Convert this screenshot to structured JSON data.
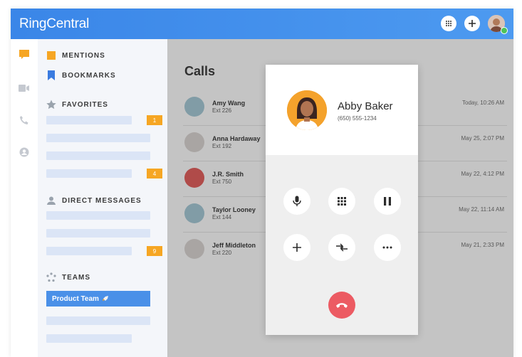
{
  "app": {
    "logo_text": "RingCentral",
    "accent": "#4a90e8"
  },
  "topbar": {
    "dialpad_icon": "dialpad-icon",
    "add_icon": "plus-icon",
    "avatar": "user-avatar",
    "presence_color": "#4cc35a"
  },
  "rail": {
    "icons": [
      "chat-bubble-icon",
      "video-icon",
      "phone-icon",
      "contacts-icon"
    ]
  },
  "sidebar": {
    "mentions": "MENTIONS",
    "bookmarks": "BOOKMARKS",
    "favorites": "FAVORITES",
    "favorites_badges": [
      "1",
      "4"
    ],
    "direct_messages": "DIRECT MESSAGES",
    "dm_badge": "9",
    "teams": "TEAMS",
    "selected_team": "Product Team",
    "badge_color": "#f6a623"
  },
  "main": {
    "title": "Calls",
    "calls": [
      {
        "name": "Amy Wang",
        "ext": "Ext 226",
        "time": "Today, 10:26 AM",
        "color": "#9fc6d4"
      },
      {
        "name": "Anna Hardaway",
        "ext": "Ext 192",
        "time": "May 25, 2:07 PM",
        "color": "#d9d3d0"
      },
      {
        "name": "J.R. Smith",
        "ext": "Ext 750",
        "time": "May 22, 4:12 PM",
        "color": "#e3524f"
      },
      {
        "name": "Taylor Looney",
        "ext": "Ext 144",
        "time": "May 22, 11:14 AM",
        "color": "#9fc6d4"
      },
      {
        "name": "Jeff Middleton",
        "ext": "Ext 220",
        "time": "May 21, 2:33 PM",
        "color": "#d9d3d0"
      }
    ]
  },
  "call_modal": {
    "caller_name": "Abby Baker",
    "caller_number": "(650) 555-1234",
    "controls": [
      "microphone-icon",
      "keypad-icon",
      "pause-icon",
      "add-icon",
      "transfer-icon",
      "more-icon"
    ],
    "hangup_color": "#ec5b63"
  }
}
